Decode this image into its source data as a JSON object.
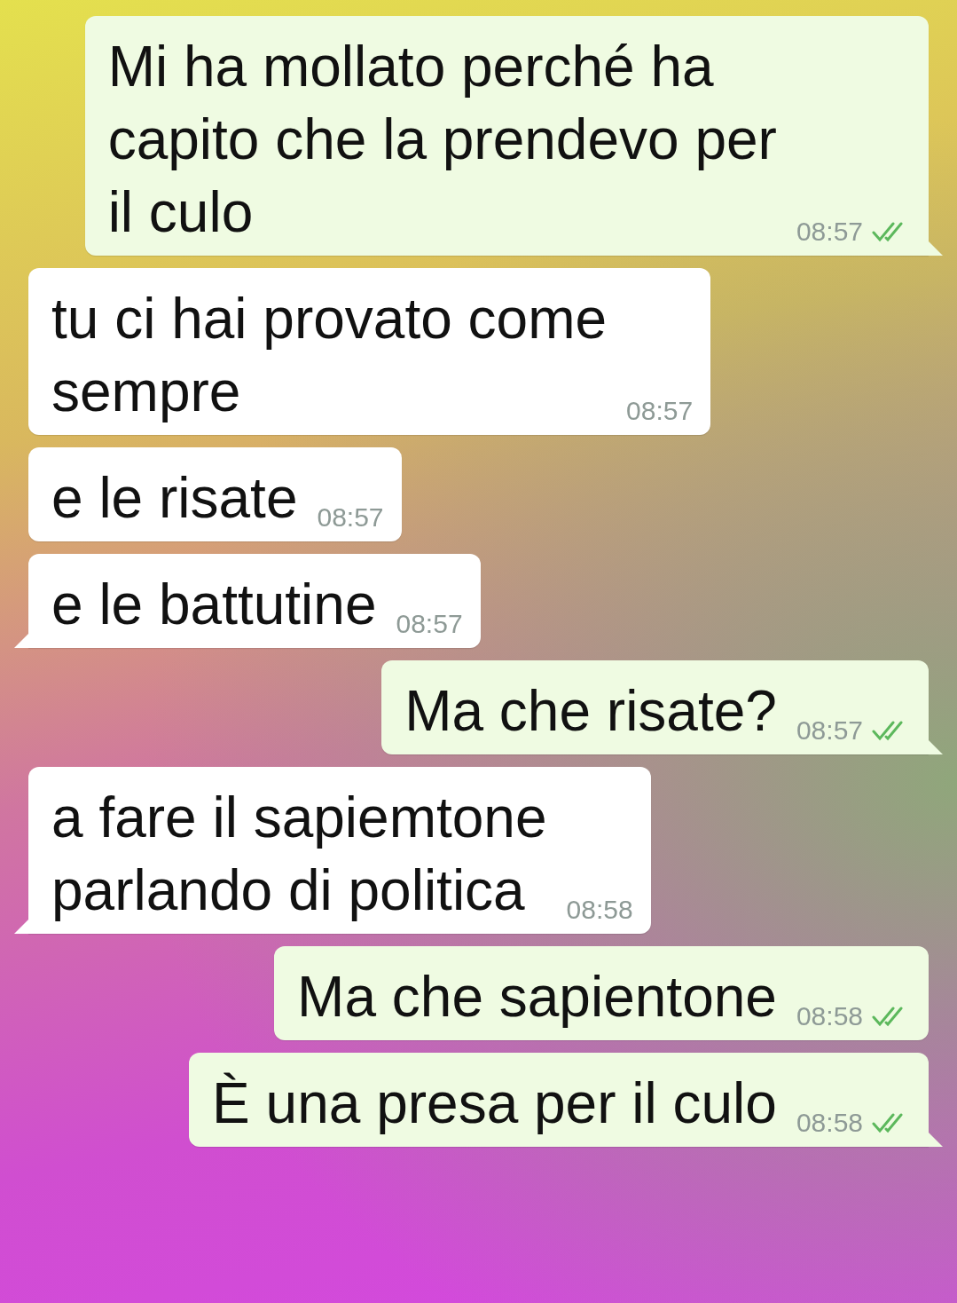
{
  "messages": [
    {
      "kind": "outgoing",
      "text": "Mi ha mollato perché ha\ncapito che la prendevo per\nil culo",
      "time": "08:57",
      "read": true,
      "tail": true
    },
    {
      "kind": "incoming",
      "text": "tu ci hai provato come\nsempre",
      "time": "08:57",
      "tail": false
    },
    {
      "kind": "incoming",
      "text": "e le risate",
      "time": "08:57",
      "tail": false
    },
    {
      "kind": "incoming",
      "text": "e le battutine",
      "time": "08:57",
      "tail": true
    },
    {
      "kind": "outgoing",
      "text": "Ma che risate?",
      "time": "08:57",
      "read": true,
      "tail": true
    },
    {
      "kind": "incoming",
      "text": "a fare il sapiemtone\nparlando di politica",
      "time": "08:58",
      "tail": true
    },
    {
      "kind": "outgoing",
      "text": "Ma che sapientone",
      "time": "08:58",
      "read": true,
      "tail": false
    },
    {
      "kind": "outgoing",
      "text": "È una presa per il culo",
      "time": "08:58",
      "read": true,
      "tail": true
    }
  ]
}
